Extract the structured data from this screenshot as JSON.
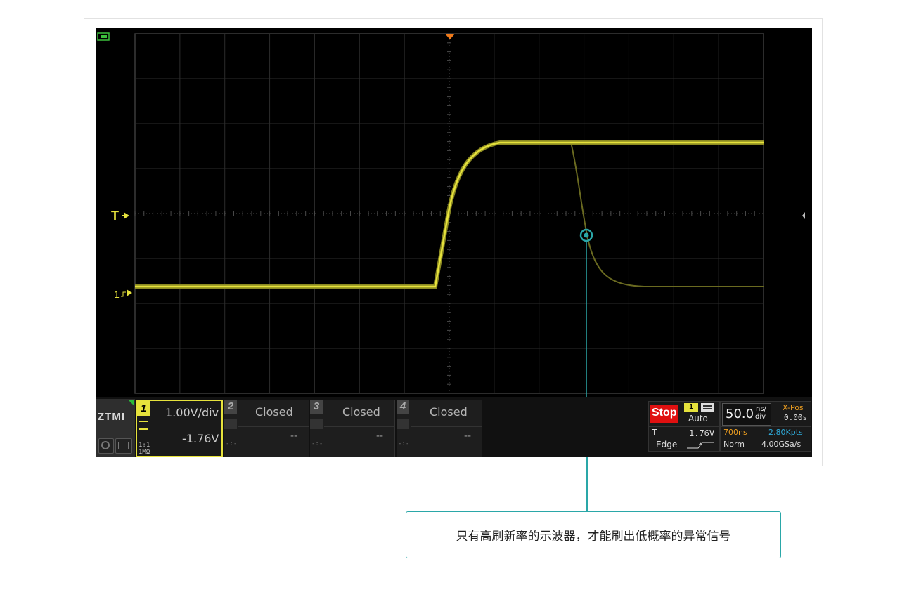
{
  "brand": {
    "logo": "ZTMI"
  },
  "trigger_marker": {
    "label": "T"
  },
  "channel_marker": {
    "label": "1"
  },
  "channels": [
    {
      "number": "1",
      "scale": "1.00V/div",
      "offset": "-1.76V",
      "probe": "1:1",
      "impedance": "1MΩ"
    },
    {
      "number": "2",
      "status": "Closed",
      "value": "--",
      "sub": "-:-"
    },
    {
      "number": "3",
      "status": "Closed",
      "value": "--",
      "sub": "-:-"
    },
    {
      "number": "4",
      "status": "Closed",
      "value": "--",
      "sub": "-:-"
    }
  ],
  "acquisition": {
    "run_state": "Stop",
    "trigger_source": "1",
    "trigger_mode": "Auto",
    "trigger_label": "T",
    "trigger_level": "1.76V",
    "trigger_type": "Edge",
    "timebase": "50.0",
    "timebase_unit_top": "ns/",
    "timebase_unit_bottom": "div",
    "xpos_label": "X-Pos",
    "xpos_value": "0.00s",
    "record_time": "700ns",
    "memory_depth": "2.80Kpts",
    "acq_mode": "Norm",
    "sample_rate": "4.00GSa/s"
  },
  "annotation": {
    "text": "只有高刷新率的示波器，才能刷出低概率的异常信号"
  },
  "colors": {
    "signal": "#e6e23c",
    "accent_teal": "#2aa7a8",
    "stop_red": "#e01010",
    "info_cyan": "#2ea9d8",
    "info_orange": "#f0a020"
  }
}
